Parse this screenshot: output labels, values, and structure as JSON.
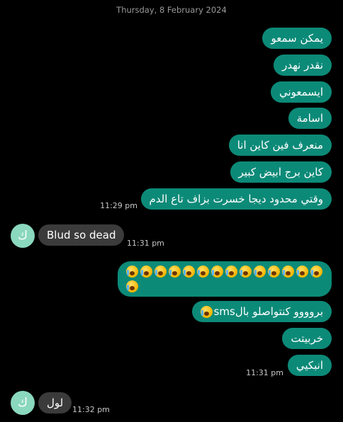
{
  "date_header": "Thursday, 8 February 2024",
  "contact": {
    "avatar_letter": "ك",
    "avatar_color": "#8ad8be"
  },
  "colors": {
    "outgoing_bubble": "#0c8a78",
    "incoming_bubble": "#3b3b3b",
    "background": "#000000"
  },
  "messages": [
    {
      "direction": "out",
      "text": "يمكن سمعو"
    },
    {
      "direction": "out",
      "text": "نقدر نهدر"
    },
    {
      "direction": "out",
      "text": "ايسمعوني"
    },
    {
      "direction": "out",
      "text": "اسامة"
    },
    {
      "direction": "out",
      "text": "منعرف فين كاين انا"
    },
    {
      "direction": "out",
      "text": "كاين برج ابيض كبير"
    },
    {
      "direction": "out",
      "text": "وقتي محدود ديجا خسرت بزاف تاع الدم",
      "time": "11:29 pm"
    },
    {
      "direction": "in",
      "text": "Blud so dead",
      "time": "11:31 pm"
    },
    {
      "direction": "out",
      "emoji": "face-screaming-in-fear",
      "emoji_count": 15
    },
    {
      "direction": "out",
      "text": "بروووو كنتواصلو بالsms",
      "emoji": "face-screaming-in-fear"
    },
    {
      "direction": "out",
      "text": "خربيتت"
    },
    {
      "direction": "out",
      "text": "انبكيي",
      "time": "11:31 pm"
    },
    {
      "direction": "in",
      "text": "لول",
      "time": "11:32 pm"
    }
  ]
}
